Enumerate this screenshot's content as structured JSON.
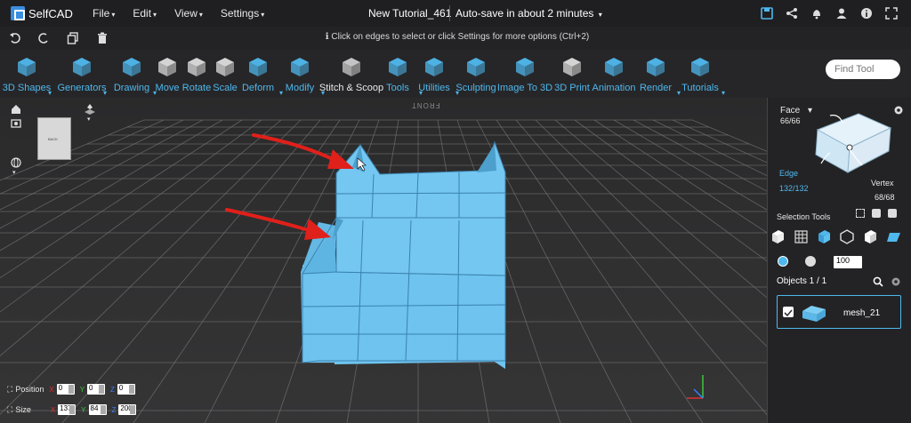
{
  "menubar": {
    "logo_text": "SelfCAD",
    "menus": [
      "File",
      "Edit",
      "View",
      "Settings"
    ],
    "doc_title": "New Tutorial_461",
    "autosave": "Auto-save in about 2 minutes"
  },
  "hint": "Click on edges to select or click Settings for more options (Ctrl+2)",
  "toolbar": {
    "tools": [
      {
        "label": "3D Shapes",
        "dropdown": true
      },
      {
        "label": "Generators",
        "dropdown": true
      },
      {
        "label": "Drawing",
        "dropdown": true
      },
      {
        "label": "Move",
        "dropdown": false
      },
      {
        "label": "Rotate",
        "dropdown": false
      },
      {
        "label": "Scale",
        "dropdown": false
      },
      {
        "label": "Deform",
        "dropdown": true
      },
      {
        "label": "Modify",
        "dropdown": true
      },
      {
        "label": "Stitch & Scoop",
        "dropdown": false
      },
      {
        "label": "Tools",
        "dropdown": true
      },
      {
        "label": "Utilities",
        "dropdown": true
      },
      {
        "label": "Sculpting",
        "dropdown": false
      },
      {
        "label": "Image To 3D",
        "dropdown": false
      },
      {
        "label": "3D Print",
        "dropdown": false
      },
      {
        "label": "Animation",
        "dropdown": false
      },
      {
        "label": "Render",
        "dropdown": true
      },
      {
        "label": "Tutorials",
        "dropdown": true
      }
    ],
    "find_placeholder": "Find Tool"
  },
  "viewport": {
    "front_label": "FRONT",
    "cube_labels": [
      "BACK"
    ]
  },
  "panel": {
    "face_label": "Face",
    "face_count": "66/66",
    "edge_label": "Edge",
    "edge_count": "132/132",
    "vertex_label": "Vertex",
    "vertex_count": "68/68",
    "selection_tools": "Selection Tools",
    "brush_size": "100",
    "objects_title": "Objects 1 / 1",
    "mesh_name": "mesh_21"
  },
  "transform": {
    "position_label": "Position",
    "size_label": "Size",
    "axes": [
      "X",
      "Y",
      "Z"
    ],
    "position": [
      "0",
      "0",
      "0"
    ],
    "size": [
      "137",
      "84",
      "200"
    ]
  },
  "colors": {
    "accent": "#4fb8ee",
    "mesh": "#6ec3ef",
    "arrow": "#e0201a"
  }
}
